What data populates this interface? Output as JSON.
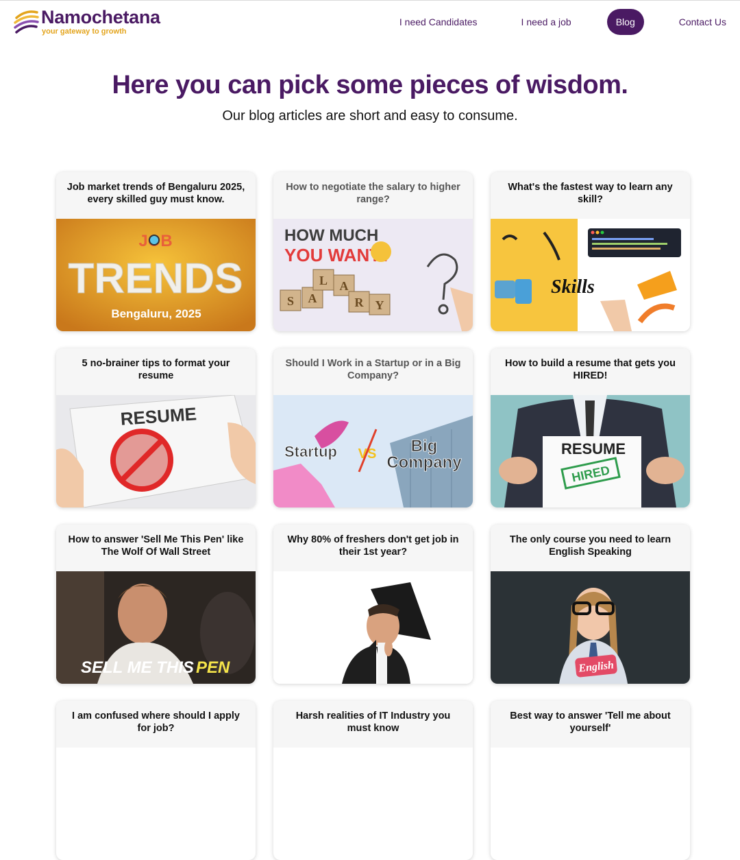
{
  "brand": {
    "name": "Namochetana",
    "tagline": "your gateway to growth"
  },
  "nav": {
    "items": [
      {
        "label": "I need Candidates"
      },
      {
        "label": "I need a job"
      },
      {
        "label": "Blog",
        "active": true
      },
      {
        "label": "Contact Us"
      }
    ]
  },
  "hero": {
    "title": "Here you can pick some pieces of wisdom.",
    "subtitle": "Our blog articles are short and easy to consume."
  },
  "colors": {
    "brand": "#4a1a63",
    "accent": "#e3a41c",
    "card_header": "#f6f6f6"
  },
  "posts": [
    {
      "title": "Job market trends of Bengaluru 2025, every skilled guy must know.",
      "image_text": [
        "JOB",
        "TRENDS",
        "Bengaluru, 2025"
      ]
    },
    {
      "title": "How to negotiate the salary to higher range?",
      "image_text": [
        "HOW MUCH",
        "YOU WANT?",
        "S",
        "A",
        "L",
        "A",
        "R",
        "Y"
      ]
    },
    {
      "title": "What's the fastest way to learn any skill?",
      "image_text": [
        "Skills"
      ]
    },
    {
      "title": "5 no-brainer tips to format your resume",
      "image_text": [
        "RESUME"
      ]
    },
    {
      "title": "Should I Work in a Startup or in a Big Company?",
      "image_text": [
        "Startup",
        "VS",
        "Big",
        "Company"
      ]
    },
    {
      "title": "How to build a resume that gets you HIRED!",
      "image_text": [
        "RESUME",
        "HIRED"
      ]
    },
    {
      "title": "How to answer 'Sell Me This Pen' like The Wolf Of Wall Street",
      "image_text": [
        "SELL ME THIS",
        "PEN"
      ]
    },
    {
      "title": "Why 80% of freshers don't get job in their 1st year?",
      "image_text": []
    },
    {
      "title": "The only course you need to learn English Speaking",
      "image_text": [
        "English"
      ]
    },
    {
      "title": "I am confused where should I apply for job?",
      "image_text": []
    },
    {
      "title": "Harsh realities of IT Industry you must know",
      "image_text": []
    },
    {
      "title": "Best way to answer 'Tell me about yourself'",
      "image_text": []
    }
  ]
}
